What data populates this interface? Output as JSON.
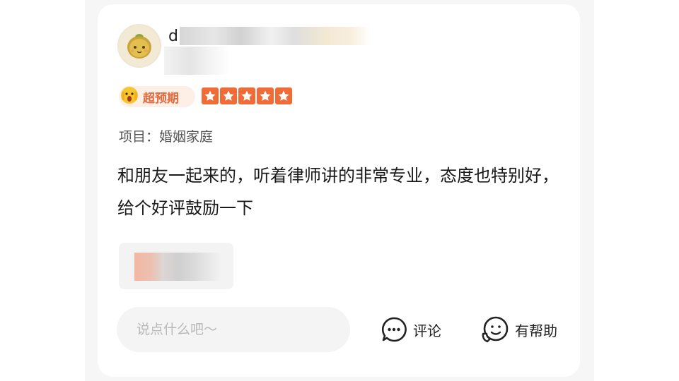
{
  "review": {
    "user": {
      "name_visible": "d",
      "avatar": "kiwi-avatar"
    },
    "badge": {
      "icon": "shocked-face-emoji",
      "label": "超预期"
    },
    "rating": {
      "stars": 5,
      "max": 5,
      "color": "#f06b35"
    },
    "project": "项目：婚姻家庭",
    "text": "和朋友一起来的，听着律师讲的非常专业，态度也特别好，给个好评鼓励一下"
  },
  "footer": {
    "comment_placeholder": "说点什么吧～",
    "comment_label": "评论",
    "helpful_label": "有帮助"
  },
  "colors": {
    "accent": "#f06b35",
    "badge_bg": "#fdeee6",
    "badge_text": "#e26a3f"
  }
}
